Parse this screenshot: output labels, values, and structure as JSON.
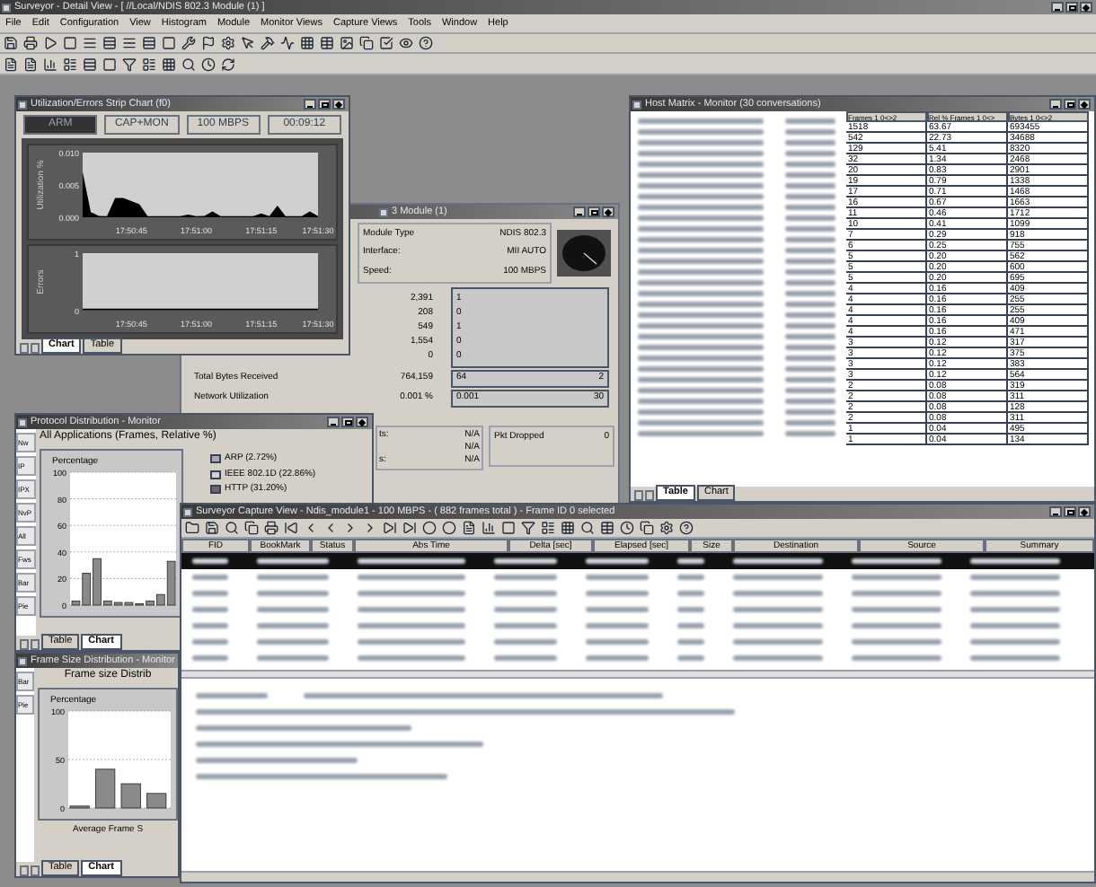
{
  "window": {
    "title": "Surveyor - Detail View - [ //Local/NDIS 802.3 Module (1) ]"
  },
  "menu": [
    "File",
    "Edit",
    "Configuration",
    "View",
    "Histogram",
    "Module",
    "Monitor Views",
    "Capture Views",
    "Tools",
    "Window",
    "Help"
  ],
  "strip_chart": {
    "title": "Utilization/Errors Strip Chart (f0)",
    "status": [
      {
        "text": "ARM",
        "highlighted": true
      },
      {
        "text": "CAP+MON",
        "highlighted": false
      },
      {
        "text": "100 MBPS",
        "highlighted": false
      },
      {
        "text": "00:09:12",
        "highlighted": false
      }
    ],
    "utilization": {
      "chart_data": {
        "type": "area",
        "ylabel": "Utilization %",
        "categories": [
          null,
          null,
          null,
          null,
          null,
          null,
          "17:50:45",
          null,
          null,
          null,
          null,
          null,
          null,
          null,
          "17:51:00",
          null,
          null,
          null,
          null,
          null,
          null,
          null,
          "17:51:15",
          null,
          null,
          null,
          null,
          null,
          null,
          "17:51:30"
        ],
        "series": [
          {
            "color": "#000000",
            "values": [
              0.007,
              0.0008,
              0.0002,
              0.0001,
              0.003,
              0.003,
              0.0025,
              0.002,
              0.0001,
              0.0001,
              0.0001,
              0.0001,
              0.0001,
              0.0004,
              0.0001,
              0.0002,
              0.0009,
              0.0001,
              0.0001,
              0.0001,
              0.0001,
              0.0001,
              0.0006,
              0.0001,
              0.0018,
              0.0001,
              0.0001,
              0.0001,
              0.0009,
              0.0001
            ]
          }
        ],
        "ylim": [
          0,
          0.01
        ],
        "yticks": [
          {
            "value": 0,
            "label": "0.000"
          },
          {
            "value": 0.005,
            "label": "0.005"
          },
          {
            "value": 0.01,
            "label": "0.010"
          }
        ]
      }
    },
    "errors": {
      "chart_data": {
        "type": "line",
        "ylabel": "Errors",
        "categories": [
          null,
          null,
          null,
          null,
          null,
          null,
          "17:50:45",
          null,
          null,
          null,
          null,
          null,
          null,
          null,
          "17:51:00",
          null,
          null,
          null,
          null,
          null,
          null,
          null,
          "17:51:15",
          null,
          null,
          null,
          null,
          null,
          null,
          "17:51:30"
        ],
        "series": [
          {
            "color": "#000000",
            "values": [
              0,
              0,
              0,
              0,
              0,
              0,
              0,
              0,
              0,
              0,
              0,
              0,
              0,
              0,
              0,
              0,
              0,
              0,
              0,
              0,
              0,
              0,
              0,
              0,
              0,
              0,
              0,
              0,
              0,
              0
            ]
          }
        ],
        "ylim": [
          0,
          1
        ],
        "yticks": [
          0,
          1
        ]
      }
    },
    "tabs": [
      {
        "label": "Chart",
        "selected": true
      },
      {
        "label": "Table",
        "selected": false
      }
    ]
  },
  "module": {
    "title": "3 Module (1)",
    "info": [
      {
        "label": "Module Type",
        "value": "NDIS 802.3"
      },
      {
        "label": "Interface:",
        "value": "MII AUTO"
      },
      {
        "label": "Speed:",
        "value": "100 MBPS"
      }
    ],
    "counts": [
      "2,391",
      "208",
      "549",
      "1,554",
      "0"
    ],
    "graph_labels": [
      "1",
      "0",
      "1",
      "0",
      "0"
    ],
    "totals": [
      {
        "label": "Total Bytes Received",
        "value": "764,159",
        "bar_label": "64",
        "bar_end": "2"
      },
      {
        "label": "Network Utilization",
        "value": "0.001 %",
        "bar_label": "0.001",
        "bar_end": "30"
      }
    ],
    "errors": [
      {
        "label": "ts:",
        "value": "N/A"
      },
      {
        "value": "N/A"
      },
      {
        "label": "s:",
        "value": "N/A"
      }
    ],
    "dropped": {
      "label": "Pkt Dropped",
      "value": "0"
    }
  },
  "host_matrix": {
    "title": "Host Matrix - Monitor (30 conversations)",
    "columns": [
      "Frames 1 0<>2",
      "Rel % Frames 1 0<>",
      "Bytes 1 0<>2"
    ],
    "rows": [
      [
        "1518",
        "63.67",
        "693455"
      ],
      [
        "542",
        "22.73",
        "34688"
      ],
      [
        "129",
        "5.41",
        "8320"
      ],
      [
        "32",
        "1.34",
        "2468"
      ],
      [
        "20",
        "0.83",
        "2901"
      ],
      [
        "19",
        "0.79",
        "1338"
      ],
      [
        "17",
        "0.71",
        "1468"
      ],
      [
        "16",
        "0.67",
        "1663"
      ],
      [
        "11",
        "0.46",
        "1712"
      ],
      [
        "10",
        "0.41",
        "1099"
      ],
      [
        "7",
        "0.29",
        "918"
      ],
      [
        "6",
        "0.25",
        "755"
      ],
      [
        "5",
        "0.20",
        "562"
      ],
      [
        "5",
        "0.20",
        "600"
      ],
      [
        "5",
        "0.20",
        "695"
      ],
      [
        "4",
        "0.16",
        "409"
      ],
      [
        "4",
        "0.16",
        "255"
      ],
      [
        "4",
        "0.16",
        "255"
      ],
      [
        "4",
        "0.16",
        "409"
      ],
      [
        "4",
        "0.16",
        "471"
      ],
      [
        "3",
        "0.12",
        "317"
      ],
      [
        "3",
        "0.12",
        "375"
      ],
      [
        "3",
        "0.12",
        "383"
      ],
      [
        "3",
        "0.12",
        "564"
      ],
      [
        "2",
        "0.08",
        "319"
      ],
      [
        "2",
        "0.08",
        "311"
      ],
      [
        "2",
        "0.08",
        "128"
      ],
      [
        "2",
        "0.08",
        "311"
      ],
      [
        "1",
        "0.04",
        "495"
      ],
      [
        "1",
        "0.04",
        "134"
      ]
    ],
    "tabs": [
      {
        "label": "Table",
        "selected": true
      },
      {
        "label": "Chart",
        "selected": false
      }
    ]
  },
  "protocol": {
    "title": "Protocol Distribution - Monitor",
    "heading": "All Applications (Frames, Relative %)",
    "side_buttons": [
      "Nw",
      "IP",
      "IPX",
      "NvP",
      "All",
      "Fws",
      "Bar",
      "Pie"
    ],
    "legend": [
      {
        "label": "ARP (2.72%)",
        "color": "#a8a8a8"
      },
      {
        "label": "IEEE 802.1D (22.86%)",
        "color": "#d0d0d0"
      },
      {
        "label": "HTTP (31.20%)",
        "color": "#686868"
      }
    ],
    "chart_data": {
      "type": "bar",
      "ylabel": "Percentage",
      "ylim": [
        0,
        100
      ],
      "yticks": [
        0,
        20,
        40,
        60,
        80,
        100
      ],
      "grid": true,
      "series": [
        {
          "color": "#8a8a8a",
          "values": [
            3,
            24,
            35,
            3,
            2,
            2,
            1,
            3,
            8,
            33
          ]
        }
      ]
    },
    "tabs": [
      {
        "label": "Table",
        "selected": false
      },
      {
        "label": "Chart",
        "selected": true
      }
    ]
  },
  "frame_size": {
    "title": "Frame Size Distribution - Monitor",
    "side_buttons": [
      "Bar",
      "Pie"
    ],
    "heading": "Frame size Distrib",
    "chart_data": {
      "type": "bar",
      "ylabel": "Percentage",
      "ylim": [
        0,
        100
      ],
      "yticks": [
        0,
        50,
        100
      ],
      "grid": true,
      "series": [
        {
          "color": "#8a8a8a",
          "values": [
            2,
            40,
            25,
            15
          ]
        }
      ]
    },
    "footer": "Average Frame S",
    "tabs": [
      {
        "label": "Table",
        "selected": false
      },
      {
        "label": "Chart",
        "selected": true
      }
    ]
  },
  "capture": {
    "title": "Surveyor Capture View - Ndis_module1 - 100 MBPS - ( 882 frames total ) - Frame ID 0 selected",
    "columns": [
      "FID",
      "BookMark",
      "Status",
      "Abs Time",
      "Delta [sec]",
      "Elapsed [sec]",
      "Size",
      "Destination",
      "Source",
      "Summary"
    ],
    "rows": [
      {
        "selected": true
      },
      {
        "selected": false
      },
      {
        "selected": false
      },
      {
        "selected": false
      },
      {
        "selected": false
      },
      {
        "selected": false
      },
      {
        "selected": false
      }
    ]
  }
}
